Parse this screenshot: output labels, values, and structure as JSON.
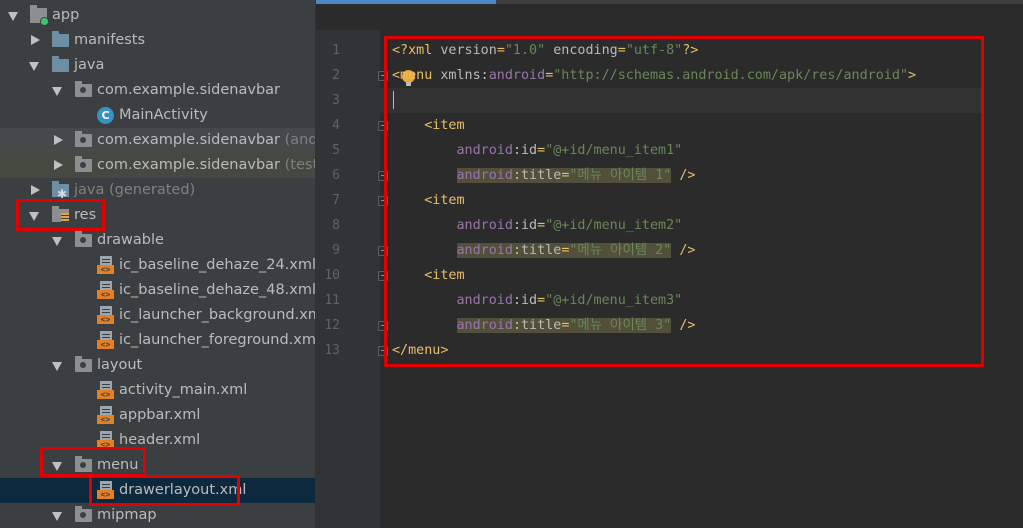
{
  "tree": {
    "items": [
      {
        "label": "app",
        "dim": ""
      },
      {
        "label": "manifests",
        "dim": ""
      },
      {
        "label": "java",
        "dim": ""
      },
      {
        "label": "com.example.sidenavbar",
        "dim": ""
      },
      {
        "label": "MainActivity",
        "dim": ""
      },
      {
        "label": "com.example.sidenavbar",
        "dim": " (andro"
      },
      {
        "label": "com.example.sidenavbar",
        "dim": " (test)"
      },
      {
        "label": "java",
        "dim": " (generated)"
      },
      {
        "label": "res",
        "dim": ""
      },
      {
        "label": "drawable",
        "dim": ""
      },
      {
        "label": "ic_baseline_dehaze_24.xml",
        "dim": ""
      },
      {
        "label": "ic_baseline_dehaze_48.xml",
        "dim": ""
      },
      {
        "label": "ic_launcher_background.xml",
        "dim": ""
      },
      {
        "label": "ic_launcher_foreground.xml",
        "dim": " ("
      },
      {
        "label": "layout",
        "dim": ""
      },
      {
        "label": "activity_main.xml",
        "dim": ""
      },
      {
        "label": "appbar.xml",
        "dim": ""
      },
      {
        "label": "header.xml",
        "dim": ""
      },
      {
        "label": "menu",
        "dim": ""
      },
      {
        "label": "drawerlayout.xml",
        "dim": ""
      },
      {
        "label": "mipmap",
        "dim": ""
      }
    ]
  },
  "editor": {
    "line_numbers": [
      "1",
      "2",
      "3",
      "4",
      "5",
      "6",
      "7",
      "8",
      "9",
      "10",
      "11",
      "12",
      "13"
    ],
    "lines": [
      {
        "indent": "",
        "parts": [
          [
            "tag",
            "<?xml "
          ],
          [
            "attr",
            "version"
          ],
          [
            "plain",
            "="
          ],
          [
            "str",
            "\"1.0\""
          ],
          [
            "plain",
            " "
          ],
          [
            "attr",
            "encoding"
          ],
          [
            "plain",
            "="
          ],
          [
            "str",
            "\"utf-8\""
          ],
          [
            "tag",
            "?>"
          ]
        ]
      },
      {
        "indent": "",
        "parts": [
          [
            "tag",
            "<menu "
          ],
          [
            "attr",
            "xmlns:"
          ],
          [
            "ns",
            "android"
          ],
          [
            "plain",
            "="
          ],
          [
            "str",
            "\"http://schemas.android.com/apk/res/android\""
          ],
          [
            "tag",
            ">"
          ]
        ]
      },
      {
        "indent": "",
        "parts": []
      },
      {
        "indent": "    ",
        "parts": [
          [
            "tag",
            "<item"
          ]
        ]
      },
      {
        "indent": "        ",
        "parts": [
          [
            "ns",
            "android"
          ],
          [
            "attr",
            ":id"
          ],
          [
            "plain",
            "="
          ],
          [
            "str",
            "\"@+id/menu_item1\""
          ]
        ]
      },
      {
        "indent": "        ",
        "parts": [
          [
            "ns",
            "android",
            1
          ],
          [
            "attr",
            ":title",
            1
          ],
          [
            "plain",
            "=",
            1
          ],
          [
            "str",
            "\"메뉴 아이템 1\"",
            1
          ],
          [
            "plain",
            " "
          ],
          [
            "tag",
            "/>"
          ]
        ]
      },
      {
        "indent": "    ",
        "parts": [
          [
            "tag",
            "<item"
          ]
        ]
      },
      {
        "indent": "        ",
        "parts": [
          [
            "ns",
            "android"
          ],
          [
            "attr",
            ":id"
          ],
          [
            "plain",
            "="
          ],
          [
            "str",
            "\"@+id/menu_item2\""
          ]
        ]
      },
      {
        "indent": "        ",
        "parts": [
          [
            "ns",
            "android",
            1
          ],
          [
            "attr",
            ":title",
            1
          ],
          [
            "plain",
            "=",
            1
          ],
          [
            "str",
            "\"메뉴 아이템 2\"",
            1
          ],
          [
            "plain",
            " "
          ],
          [
            "tag",
            "/>"
          ]
        ]
      },
      {
        "indent": "    ",
        "parts": [
          [
            "tag",
            "<item"
          ]
        ]
      },
      {
        "indent": "        ",
        "parts": [
          [
            "ns",
            "android"
          ],
          [
            "attr",
            ":id"
          ],
          [
            "plain",
            "="
          ],
          [
            "str",
            "\"@+id/menu_item3\""
          ]
        ]
      },
      {
        "indent": "        ",
        "parts": [
          [
            "ns",
            "android",
            1
          ],
          [
            "attr",
            ":title",
            1
          ],
          [
            "plain",
            "=",
            1
          ],
          [
            "str",
            "\"메뉴 아이템 3\"",
            1
          ],
          [
            "plain",
            " "
          ],
          [
            "tag",
            "/>"
          ]
        ]
      },
      {
        "indent": "",
        "parts": [
          [
            "tag",
            "</menu>"
          ]
        ]
      }
    ]
  },
  "colors": {
    "highlight_box": "#e30000",
    "tree_bg": "#3c3f41",
    "editor_bg": "#2b2b2b",
    "xml_tag": "#e8bf6a",
    "xml_string": "#6a8759",
    "xml_namespace": "#9876aa"
  }
}
